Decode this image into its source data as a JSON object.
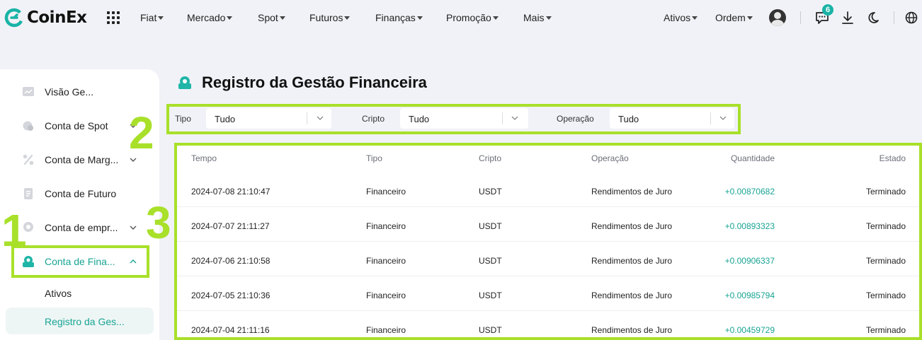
{
  "brand": {
    "name": "CoinEx",
    "accent": "#19b3a6"
  },
  "nav": {
    "items": [
      "Fiat",
      "Mercado",
      "Spot",
      "Futuros",
      "Finanças",
      "Promoção",
      "Mais"
    ],
    "right": [
      "Ativos",
      "Ordem"
    ],
    "notifications": "6",
    "icons": [
      "apps-grid-icon",
      "user-avatar-icon",
      "chat-icon",
      "download-icon",
      "moon-icon",
      "globe-icon"
    ]
  },
  "sidebar": {
    "items": [
      {
        "label": "Visão Ge...",
        "icon": "chart-icon"
      },
      {
        "label": "Conta de Spot",
        "icon": "coin-icon"
      },
      {
        "label": "Conta de Marg...",
        "icon": "percent-icon"
      },
      {
        "label": "Conta de Futuro",
        "icon": "document-icon"
      },
      {
        "label": "Conta de empr...",
        "icon": "loan-icon"
      },
      {
        "label": "Conta de Fina...",
        "icon": "finance-icon"
      }
    ],
    "subitems": [
      "Ativos",
      "Registro da Ges..."
    ]
  },
  "page": {
    "title": "Registro da Gestão Financeira"
  },
  "filters": {
    "tipo": {
      "label": "Tipo",
      "value": "Tudo"
    },
    "cripto": {
      "label": "Cripto",
      "value": "Tudo"
    },
    "operacao": {
      "label": "Operação",
      "value": "Tudo"
    }
  },
  "table": {
    "headers": [
      "Tempo",
      "Tipo",
      "Cripto",
      "Operação",
      "Quantidade",
      "Estado"
    ],
    "rows": [
      [
        "2024-07-08 21:10:47",
        "Financeiro",
        "USDT",
        "Rendimentos de Juro",
        "+0.00870682",
        "Terminado"
      ],
      [
        "2024-07-07 21:11:27",
        "Financeiro",
        "USDT",
        "Rendimentos de Juro",
        "+0.00893323",
        "Terminado"
      ],
      [
        "2024-07-06 21:10:58",
        "Financeiro",
        "USDT",
        "Rendimentos de Juro",
        "+0.00906337",
        "Terminado"
      ],
      [
        "2024-07-05 21:10:36",
        "Financeiro",
        "USDT",
        "Rendimentos de Juro",
        "+0.00985794",
        "Terminado"
      ],
      [
        "2024-07-04 21:11:16",
        "Financeiro",
        "USDT",
        "Rendimentos de Juro",
        "+0.00459729",
        "Terminado"
      ]
    ]
  },
  "annotations": [
    "1",
    "2",
    "3"
  ],
  "colors": {
    "positive": "#18a493",
    "highlight": "#a8e02a"
  }
}
